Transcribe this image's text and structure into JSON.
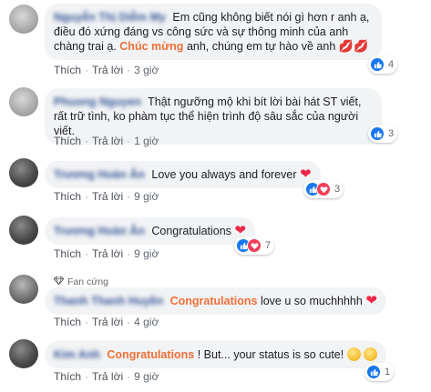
{
  "comments": [
    {
      "author": "Nguyễn Thị Diễm My",
      "text_a": "Em cũng không biết nói gì hơn r anh ạ, điều đó xứng đáng vs công sức và sự thông minh của anh chàng trai ạ.",
      "highlight": "Chúc mừng",
      "text_b": "anh, chúng em tự hào về anh",
      "emoji_label": "💋💋",
      "reaction_count": "4",
      "like": "Thích",
      "reply": "Trả lời",
      "time": "3 giờ"
    },
    {
      "author": "Phuong Nguyen",
      "text_a": "Thật ngưỡng mộ khi bít lời bài hát ST viết, rất trữ tình, ko phàm tục thể hiện trình độ sâu sắc của người viết.",
      "reaction_count": "3",
      "like": "Thích",
      "reply": "Trả lời",
      "time": "1 giờ"
    },
    {
      "author": "Trương Hoàn Ân",
      "text_a": "Love you always and forever",
      "heart": "❤",
      "reaction_count": "3",
      "like": "Thích",
      "reply": "Trả lời",
      "time": "9 giờ"
    },
    {
      "author": "Trương Hoàn Ân",
      "text_a": "Congratulations",
      "heart": "❤",
      "reaction_count": "7",
      "like": "Thích",
      "reply": "Trả lời",
      "time": "9 giờ"
    },
    {
      "badge": "Fan cứng",
      "author": "Thanh Thanh Huyền",
      "highlight": "Congratulations",
      "text_b": "love u so muchhhhh",
      "heart": "❤",
      "like": "Thích",
      "reply": "Trả lời",
      "time": "4 giờ"
    },
    {
      "author": "Kim Anh",
      "highlight": "Congratulations",
      "text_b": "! But... your status is so cute!",
      "reaction_count": "1",
      "like": "Thích",
      "reply": "Trả lời",
      "time": "9 giờ"
    }
  ],
  "separator": "·",
  "icons": {
    "like": "thumbs-up-icon",
    "love": "heart-icon",
    "badge": "diamond-icon",
    "smile": "smiling-face-icon"
  },
  "colors": {
    "author": "#385898",
    "highlight": "#f0703a",
    "heart": "#f02849",
    "like_reaction": "#1877f2",
    "love_reaction": "#f33e58",
    "bubble": "#f2f3f5"
  }
}
